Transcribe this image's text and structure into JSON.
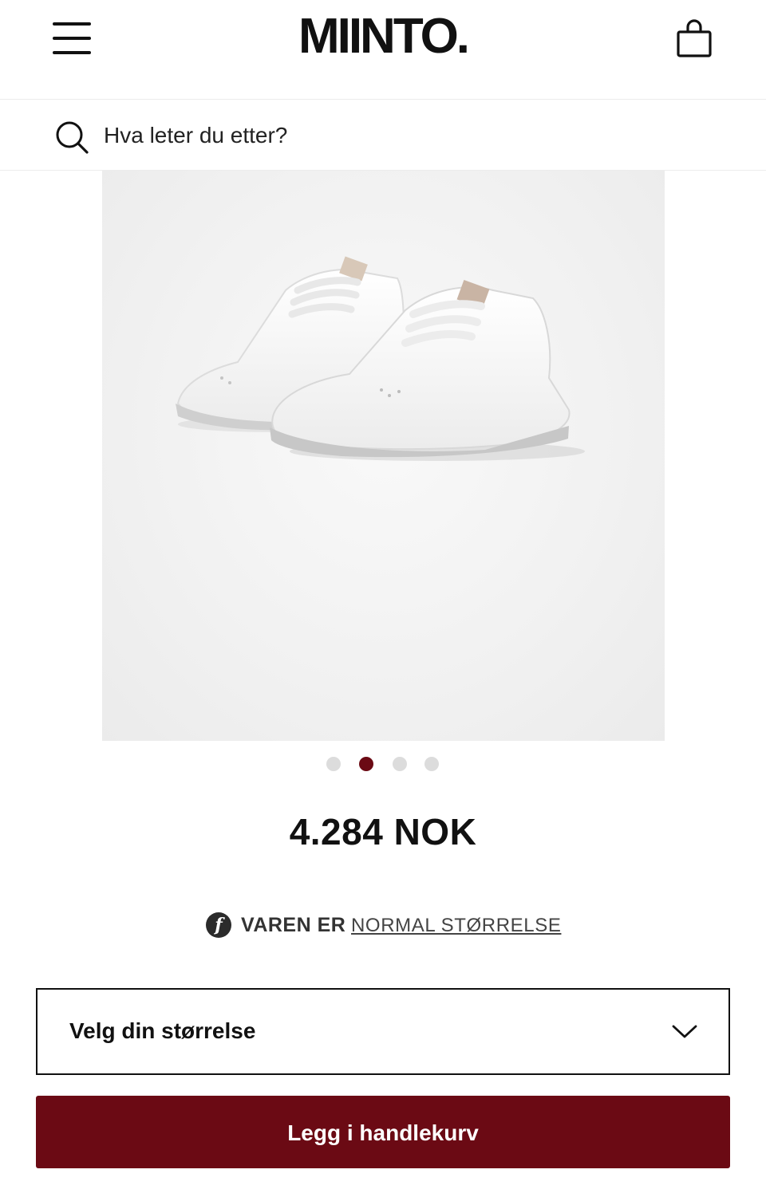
{
  "header": {
    "logo_text": "MIINTO.",
    "menu_icon": "hamburger-menu-icon",
    "bag_icon": "shopping-bag-icon"
  },
  "search": {
    "placeholder": "Hva leter du etter?",
    "icon": "search-icon"
  },
  "product": {
    "image_alt": "white sneakers",
    "gallery": {
      "count": 4,
      "active_index": 1
    },
    "price": "4.284 NOK"
  },
  "fit": {
    "icon": "fit-f-icon",
    "label": "VAREN ER",
    "link_text": "NORMAL STØRRELSE"
  },
  "size_select": {
    "label": "Velg din størrelse",
    "icon": "chevron-down-icon"
  },
  "cart": {
    "button_label": "Legg i handlekurv"
  },
  "colors": {
    "brand_accent": "#6b0a14",
    "dot_inactive": "#dcdcdc"
  }
}
